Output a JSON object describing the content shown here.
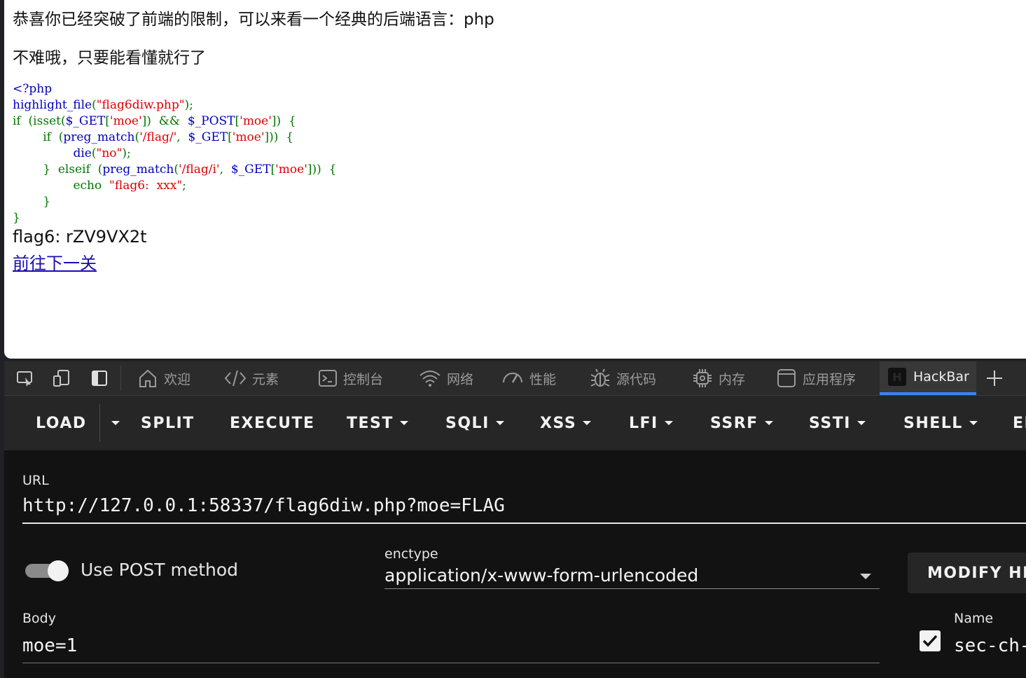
{
  "page": {
    "line1": "恭喜你已经突破了前端的限制，可以来看一个经典的后端语言：php",
    "line2": "不难哦，只要能看懂就行了",
    "code": {
      "l1": "<?php",
      "l2a": "highlight_file",
      "l2b": "(",
      "l2c": "\"flag6diw.php\"",
      "l2d": ");",
      "l3a": "if",
      "l3b": "(isset(",
      "l3c": "$_GET",
      "l3d": "[",
      "l3e": "'moe'",
      "l3f": "])",
      "l3g": "&&",
      "l3h": "$_POST",
      "l3i": "[",
      "l3j": "'moe'",
      "l3k": "])",
      "l3l": "{",
      "l4a": "if",
      "l4b": "(",
      "l4c": "preg_match",
      "l4d": "(",
      "l4e": "'/flag/'",
      "l4f": ",",
      "l4g": "$_GET",
      "l4h": "[",
      "l4i": "'moe'",
      "l4j": "]))",
      "l4k": "{",
      "l5a": "die",
      "l5b": "(",
      "l5c": "\"no\"",
      "l5d": ");",
      "l6a": "}",
      "l6b": "elseif",
      "l6c": "(",
      "l6d": "preg_match",
      "l6e": "(",
      "l6f": "'/flag/i'",
      "l6g": ",",
      "l6h": "$_GET",
      "l6i": "[",
      "l6j": "'moe'",
      "l6k": "]))",
      "l6l": "{",
      "l7a": "echo",
      "l7b": "\"flag6:  xxx\"",
      "l7c": ";",
      "l8": "}",
      "l9": "}"
    },
    "flag_output": "flag6: rZV9VX2t",
    "next_link": "前往下一关"
  },
  "devtools": {
    "tabs": [
      {
        "label": "欢迎",
        "icon": "home-icon"
      },
      {
        "label": "元素",
        "icon": "code-brackets-icon"
      },
      {
        "label": "控制台",
        "icon": "console-icon"
      },
      {
        "label": "网络",
        "icon": "wifi-icon"
      },
      {
        "label": "性能",
        "icon": "gauge-icon"
      },
      {
        "label": "源代码",
        "icon": "bug-icon"
      },
      {
        "label": "内存",
        "icon": "chip-icon"
      },
      {
        "label": "应用程序",
        "icon": "app-window-icon"
      },
      {
        "label": "HackBar",
        "icon": "hackbar-logo-icon"
      }
    ],
    "active_tab": "HackBar",
    "accent": "#3b82f6"
  },
  "hackbar": {
    "toolbar": {
      "load": "LOAD",
      "split": "SPLIT",
      "execute": "EXECUTE",
      "test": "TEST",
      "sqli": "SQLI",
      "xss": "XSS",
      "lfi": "LFI",
      "ssrf": "SSRF",
      "ssti": "SSTI",
      "shell": "SHELL",
      "more": "EI"
    },
    "url_label": "URL",
    "url_value": "http://127.0.0.1:58337/flag6diw.php?moe=FLAG",
    "post_toggle_label": "Use POST method",
    "post_enabled": true,
    "enctype_label": "enctype",
    "enctype_value": "application/x-www-form-urlencoded",
    "modify_headers_label": "MODIFY HEA",
    "body_label": "Body",
    "body_value": "moe=1",
    "header_name_label": "Name",
    "header_name_value": "sec-ch-",
    "header_checked": true
  }
}
